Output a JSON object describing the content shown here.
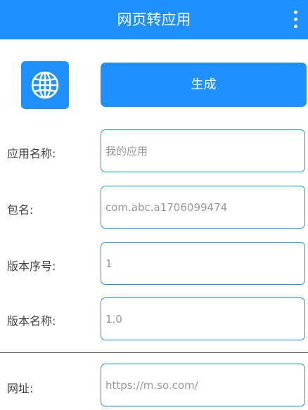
{
  "appbar": {
    "title": "网页转应用",
    "menu_icon": "more-vert-icon"
  },
  "header": {
    "app_icon": "globe-icon",
    "generate_label": "生成"
  },
  "fields": {
    "app_name": {
      "label": "应用名称:",
      "placeholder": "我的应用"
    },
    "package_name": {
      "label": "包名:",
      "placeholder": "com.abc.a1706099474"
    },
    "version_code": {
      "label": "版本序号:",
      "placeholder": "1"
    },
    "version_name": {
      "label": "版本名称:",
      "placeholder": "1.0"
    },
    "url": {
      "label": "网址:",
      "placeholder": "https://m.so.com/"
    }
  },
  "colors": {
    "primary": "#1e90ff",
    "label_text": "#444444",
    "placeholder_text": "#999999"
  }
}
